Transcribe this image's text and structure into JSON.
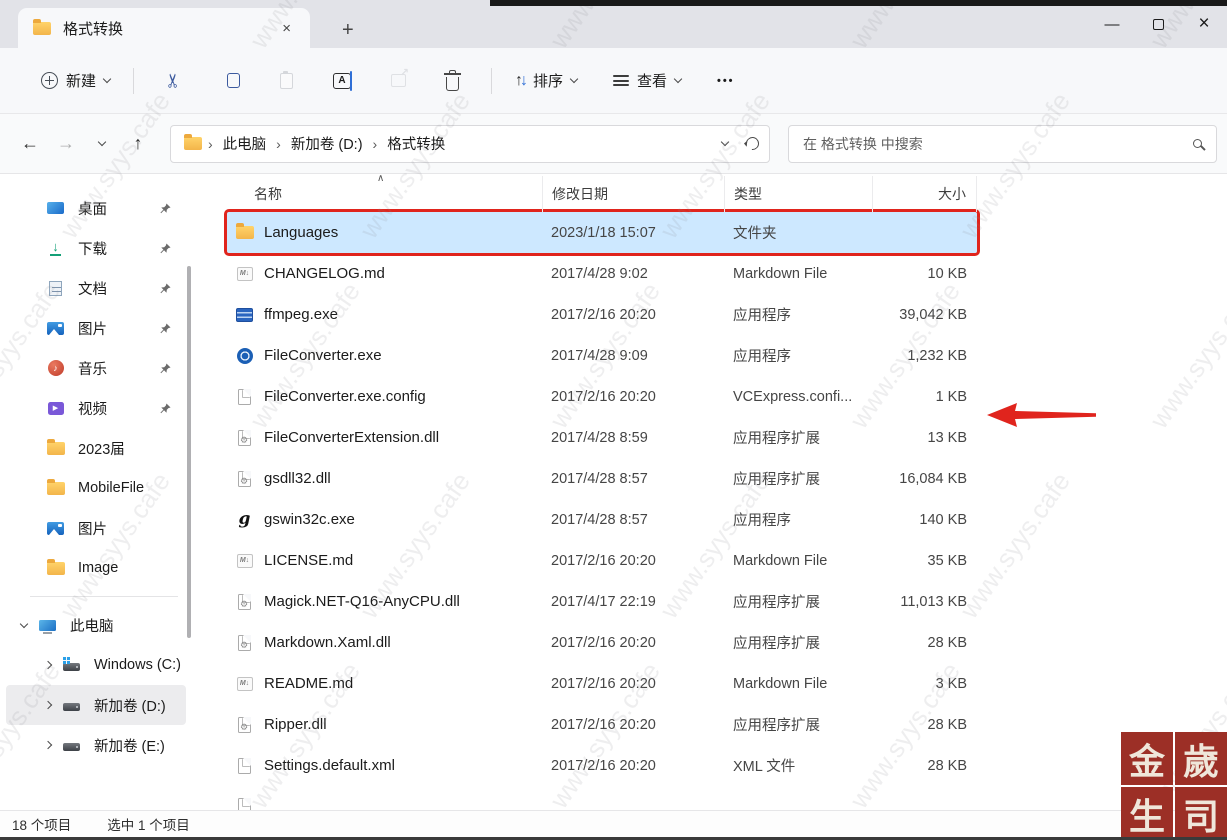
{
  "window": {
    "tab_title": "格式转换",
    "new_tab_glyph": "+",
    "minimize_glyph": "—",
    "close_glyph": "×"
  },
  "toolbar": {
    "new_label": "新建",
    "rename_glyph": "A",
    "cut_glyph": "✂",
    "sort_label": "排序",
    "sort_up_glyph": "↑",
    "sort_down_glyph": "↓",
    "view_label": "查看",
    "more_glyph": "•••"
  },
  "addressbar": {
    "back_glyph": "←",
    "forward_glyph": "→",
    "up_glyph": "↑",
    "breadcrumb": [
      "此电脑",
      "新加卷 (D:)",
      "格式转换"
    ],
    "crumb_separator": "›",
    "search_placeholder": "在 格式转换 中搜索"
  },
  "sidebar": {
    "pinned": [
      {
        "label": "桌面",
        "icon": "desktop",
        "pinned": true
      },
      {
        "label": "下载",
        "icon": "download",
        "pinned": true
      },
      {
        "label": "文档",
        "icon": "document",
        "pinned": true
      },
      {
        "label": "图片",
        "icon": "pictures",
        "pinned": true
      },
      {
        "label": "音乐",
        "icon": "music",
        "pinned": true
      },
      {
        "label": "视频",
        "icon": "videos",
        "pinned": true
      },
      {
        "label": "2023届",
        "icon": "folder",
        "pinned": false
      },
      {
        "label": "MobileFile",
        "icon": "folder",
        "pinned": false
      },
      {
        "label": "图片",
        "icon": "pictures",
        "pinned": false
      },
      {
        "label": "Image",
        "icon": "folder",
        "pinned": false
      }
    ],
    "tree": [
      {
        "label": "此电脑",
        "icon": "thispc",
        "expanded": true,
        "level": 0,
        "selected": false
      },
      {
        "label": "Windows (C:)",
        "icon": "drive-win",
        "expanded": false,
        "level": 1,
        "selected": false
      },
      {
        "label": "新加卷 (D:)",
        "icon": "drive",
        "expanded": false,
        "level": 1,
        "selected": true
      },
      {
        "label": "新加卷 (E:)",
        "icon": "drive",
        "expanded": false,
        "level": 1,
        "selected": false
      }
    ]
  },
  "filelist": {
    "columns": [
      "名称",
      "修改日期",
      "类型",
      "大小"
    ],
    "sort_indicator": "∧",
    "files": [
      {
        "name": "Languages",
        "date": "2023/1/18 15:07",
        "type": "文件夹",
        "size": "",
        "icon": "folder",
        "selected": true
      },
      {
        "name": "CHANGELOG.md",
        "date": "2017/4/28 9:02",
        "type": "Markdown File",
        "size": "10 KB",
        "icon": "md",
        "selected": false
      },
      {
        "name": "ffmpeg.exe",
        "date": "2017/2/16 20:20",
        "type": "应用程序",
        "size": "39,042 KB",
        "icon": "ffmpeg",
        "selected": false
      },
      {
        "name": "FileConverter.exe",
        "date": "2017/4/28 9:09",
        "type": "应用程序",
        "size": "1,232 KB",
        "icon": "converter",
        "selected": false
      },
      {
        "name": "FileConverter.exe.config",
        "date": "2017/2/16 20:20",
        "type": "VCExpress.confi...",
        "size": "1 KB",
        "icon": "file",
        "selected": false
      },
      {
        "name": "FileConverterExtension.dll",
        "date": "2017/4/28 8:59",
        "type": "应用程序扩展",
        "size": "13 KB",
        "icon": "dll",
        "selected": false
      },
      {
        "name": "gsdll32.dll",
        "date": "2017/4/28 8:57",
        "type": "应用程序扩展",
        "size": "16,084 KB",
        "icon": "dll",
        "selected": false
      },
      {
        "name": "gswin32c.exe",
        "date": "2017/4/28 8:57",
        "type": "应用程序",
        "size": "140 KB",
        "icon": "gs",
        "selected": false
      },
      {
        "name": "LICENSE.md",
        "date": "2017/2/16 20:20",
        "type": "Markdown File",
        "size": "35 KB",
        "icon": "md",
        "selected": false
      },
      {
        "name": "Magick.NET-Q16-AnyCPU.dll",
        "date": "2017/4/17 22:19",
        "type": "应用程序扩展",
        "size": "11,013 KB",
        "icon": "dll",
        "selected": false
      },
      {
        "name": "Markdown.Xaml.dll",
        "date": "2017/2/16 20:20",
        "type": "应用程序扩展",
        "size": "28 KB",
        "icon": "dll",
        "selected": false
      },
      {
        "name": "README.md",
        "date": "2017/2/16 20:20",
        "type": "Markdown File",
        "size": "3 KB",
        "icon": "md",
        "selected": false
      },
      {
        "name": "Ripper.dll",
        "date": "2017/2/16 20:20",
        "type": "应用程序扩展",
        "size": "28 KB",
        "icon": "dll",
        "selected": false
      },
      {
        "name": "Settings.default.xml",
        "date": "2017/2/16 20:20",
        "type": "XML 文件",
        "size": "28 KB",
        "icon": "file",
        "selected": false
      }
    ]
  },
  "statusbar": {
    "item_count": "18 个项目",
    "selected_count": "选中 1 个项目"
  },
  "annotation": {
    "color": "#e0241d"
  },
  "watermark": {
    "text": "www.syys.cafe"
  },
  "seal": {
    "chars": [
      "金",
      "歲",
      "生",
      "司"
    ]
  },
  "md_icon_text": "M↓",
  "music_note_glyph": "♪",
  "play_glyph": "▶"
}
